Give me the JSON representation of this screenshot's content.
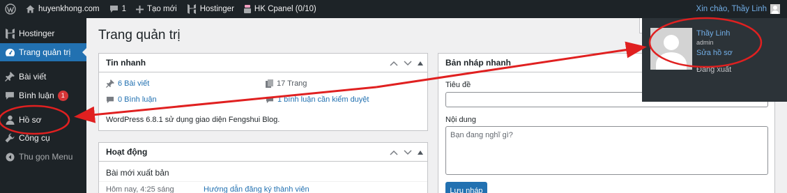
{
  "admin_bar": {
    "site_name": "huyenkhong.com",
    "comments_count": "1",
    "new_label": "Tạo mới",
    "hostinger_label": "Hostinger",
    "cpanel_label": "HK Cpanel (0/10)",
    "greeting": "Xin chào, Thầy Linh"
  },
  "sidebar": {
    "items": [
      {
        "label": "Hostinger",
        "icon": "hostinger-icon"
      },
      {
        "label": "Trang quản trị",
        "icon": "dashboard-icon"
      },
      {
        "label": "Bài viết",
        "icon": "pin-icon"
      },
      {
        "label": "Bình luận",
        "icon": "comment-icon",
        "badge": "1"
      },
      {
        "label": "Hồ sơ",
        "icon": "user-icon"
      },
      {
        "label": "Công cụ",
        "icon": "wrench-icon"
      },
      {
        "label": "Thu gọn Menu",
        "icon": "collapse-icon"
      }
    ]
  },
  "page": {
    "title": "Trang quản trị"
  },
  "at_a_glance": {
    "title": "Tin nhanh",
    "posts": "6 Bài viết",
    "pages": "17 Trang",
    "comments": "0 Bình luận",
    "moderation": "1 bình luận cần kiểm duyệt",
    "note": "WordPress 6.8.1 sử dụng giao diện Fengshui Blog."
  },
  "activity": {
    "title": "Hoạt động",
    "subtitle": "Bài mới xuất bản",
    "row_date": "Hôm nay, 4:25 sáng",
    "row_link": "Hướng dẫn đăng ký thành viên"
  },
  "quick_draft": {
    "title": "Bản nháp nhanh",
    "title_label": "Tiêu đề",
    "content_label": "Nội dung",
    "content_placeholder": "Bạn đang nghĩ gì?",
    "save_label": "Lưu nháp"
  },
  "profile_menu": {
    "name": "Thầy Linh",
    "role": "admin",
    "edit_profile": "Sửa hồ sơ",
    "logout": "Đăng xuất"
  },
  "colors": {
    "admin_bar_bg": "#1d2327",
    "accent": "#2271b1",
    "link": "#2271b1",
    "annotation_red": "#e02020",
    "badge_red": "#d63638"
  }
}
